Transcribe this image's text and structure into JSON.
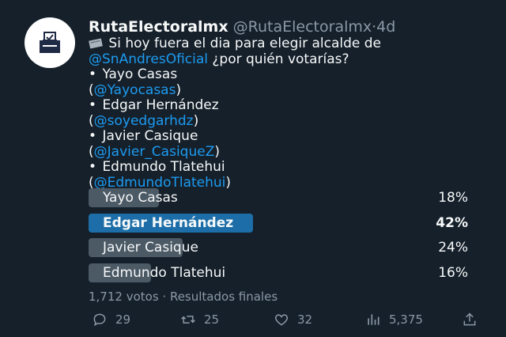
{
  "tweet": {
    "display_name": "RutaElectoralmx",
    "handle": "@RutaElectoralmx",
    "separator": "·",
    "time": "4d",
    "lines": [
      {
        "prefix": "",
        "text": " Si hoy fuera el dia para elegir alcalde de",
        "link": "",
        "suffix": ""
      },
      {
        "prefix": "",
        "text": "",
        "link": "@SnAndresOficial",
        "suffix": " ¿por quién votarías?"
      },
      {
        "prefix": "• ",
        "text": "Yayo Casas",
        "link": "",
        "suffix": ""
      },
      {
        "prefix": "(",
        "text": "",
        "link": "@Yayocasas",
        "suffix": ")"
      },
      {
        "prefix": "• ",
        "text": "Edgar Hernández",
        "link": "",
        "suffix": ""
      },
      {
        "prefix": "(",
        "text": "",
        "link": "@soyedgarhdz",
        "suffix": ")"
      },
      {
        "prefix": "• ",
        "text": "Javier Casique",
        "link": "",
        "suffix": ""
      },
      {
        "prefix": "(",
        "text": "",
        "link": "@Javier_CasiqueZ",
        "suffix": ")"
      },
      {
        "prefix": "• ",
        "text": "Edmundo Tlatehui",
        "link": "",
        "suffix": ""
      },
      {
        "prefix": "(",
        "text": "",
        "link": "@EdmundoTlatehui",
        "suffix": ")"
      }
    ]
  },
  "poll": {
    "options": [
      {
        "label": "Yayo Casas",
        "pct": "18%",
        "fraction": 0.18,
        "winner": false
      },
      {
        "label": "Edgar Hernández",
        "pct": "42%",
        "fraction": 0.42,
        "winner": true
      },
      {
        "label": "Javier Casique",
        "pct": "24%",
        "fraction": 0.24,
        "winner": false
      },
      {
        "label": "Edmundo Tlatehui",
        "pct": "16%",
        "fraction": 0.16,
        "winner": false
      }
    ],
    "votes": "1,712 votos",
    "status": "Resultados finales",
    "meta_separator": " · "
  },
  "actions": {
    "replies": "29",
    "retweets": "25",
    "likes": "32",
    "views": "5,375"
  },
  "colors": {
    "background": "#15202b",
    "link": "#1d9bf0",
    "winner_bar": "#1d6ea8",
    "bar": "#4c5a66",
    "muted": "#8b98a5"
  }
}
